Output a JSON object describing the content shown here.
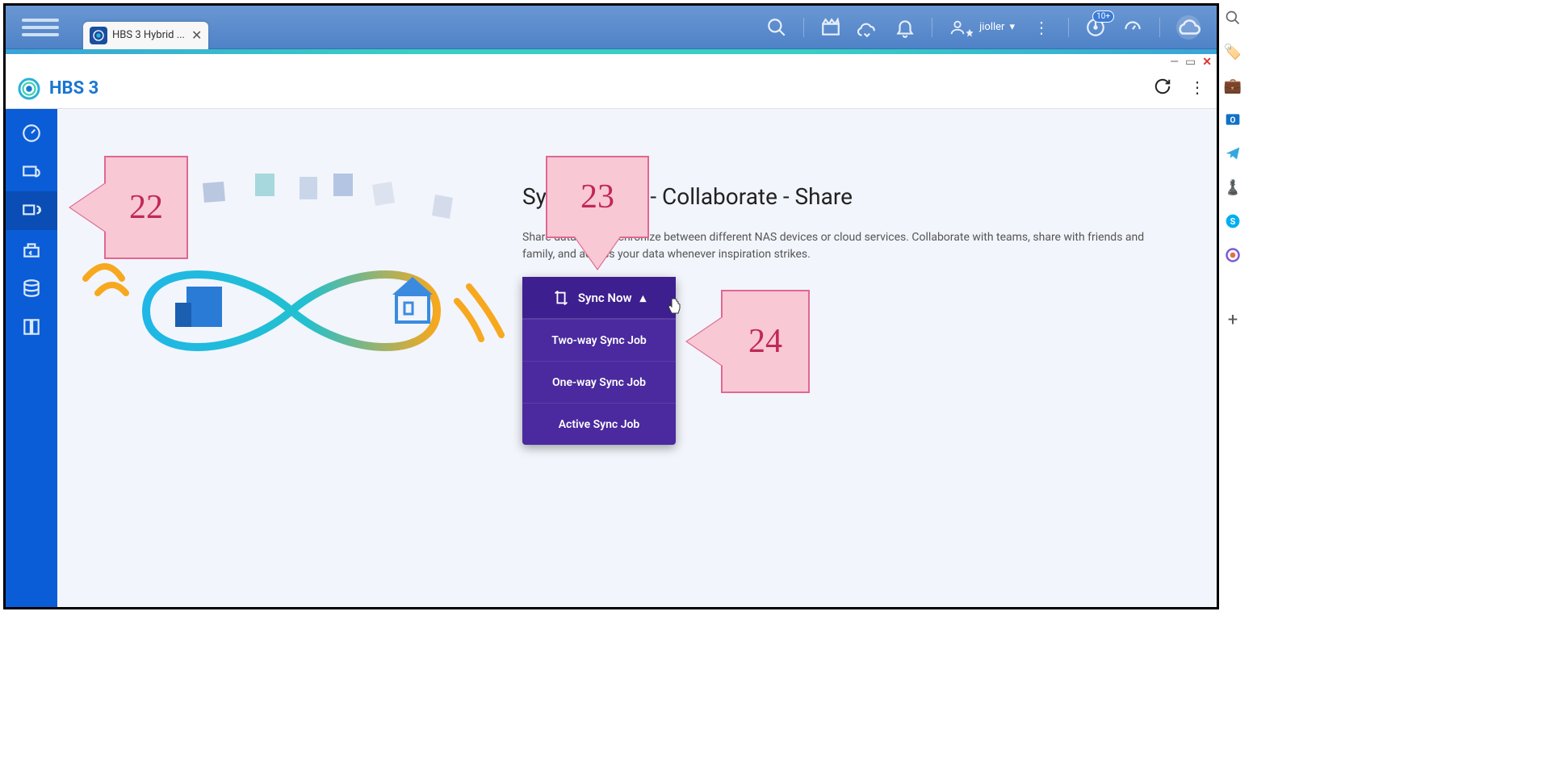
{
  "toolbar": {
    "tab_title": "HBS 3 Hybrid ...",
    "username": "jioller",
    "notif_badge": "10+"
  },
  "app": {
    "title": "HBS 3"
  },
  "content": {
    "heading": "Synchronize - Collaborate - Share",
    "description": "Share data and synchronize between different NAS devices or cloud services. Collaborate with teams, share with friends and family, and access your data whenever inspiration strikes."
  },
  "sync_menu": {
    "header": "Sync Now",
    "items": [
      "Two-way Sync Job",
      "One-way Sync Job",
      "Active Sync Job"
    ]
  },
  "callouts": {
    "c22": "22",
    "c23": "23",
    "c24": "24"
  }
}
